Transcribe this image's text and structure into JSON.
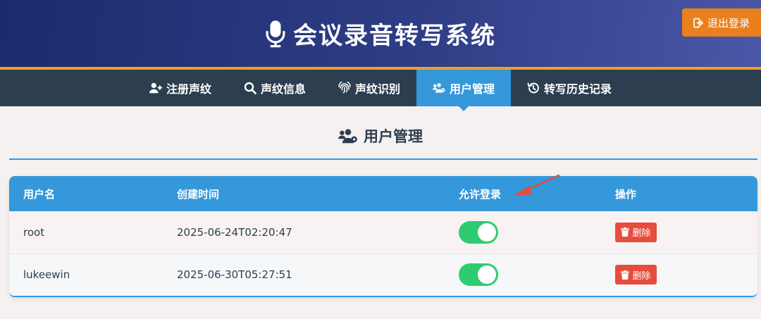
{
  "header": {
    "title": "会议录音转写系统",
    "logout_label": "退出登录",
    "accent_color": "#f0a01c",
    "icon": "microphone-icon"
  },
  "nav": {
    "items": [
      {
        "label": "注册声纹",
        "icon": "user-plus-icon"
      },
      {
        "label": "声纹信息",
        "icon": "search-icon"
      },
      {
        "label": "声纹识别",
        "icon": "fingerprint-icon"
      },
      {
        "label": "用户管理",
        "icon": "users-cog-icon",
        "active": true
      },
      {
        "label": "转写历史记录",
        "icon": "history-icon"
      }
    ],
    "active_color": "#3498db"
  },
  "section": {
    "title": "用户管理",
    "icon": "users-cog-icon"
  },
  "table": {
    "columns": [
      "用户名",
      "创建时间",
      "允许登录",
      "操作"
    ],
    "rows": [
      {
        "username": "root",
        "created": "2025-06-24T02:20:47",
        "allow_login": true,
        "action_label": "删除"
      },
      {
        "username": "lukeewin",
        "created": "2025-06-30T05:27:51",
        "allow_login": true,
        "action_label": "删除"
      }
    ],
    "header_color": "#3498db",
    "toggle_on_color": "#2ecc71",
    "delete_color": "#e74c3c"
  },
  "annotation": {
    "arrow_color": "#e74c3c",
    "points_to": "允许登录"
  }
}
